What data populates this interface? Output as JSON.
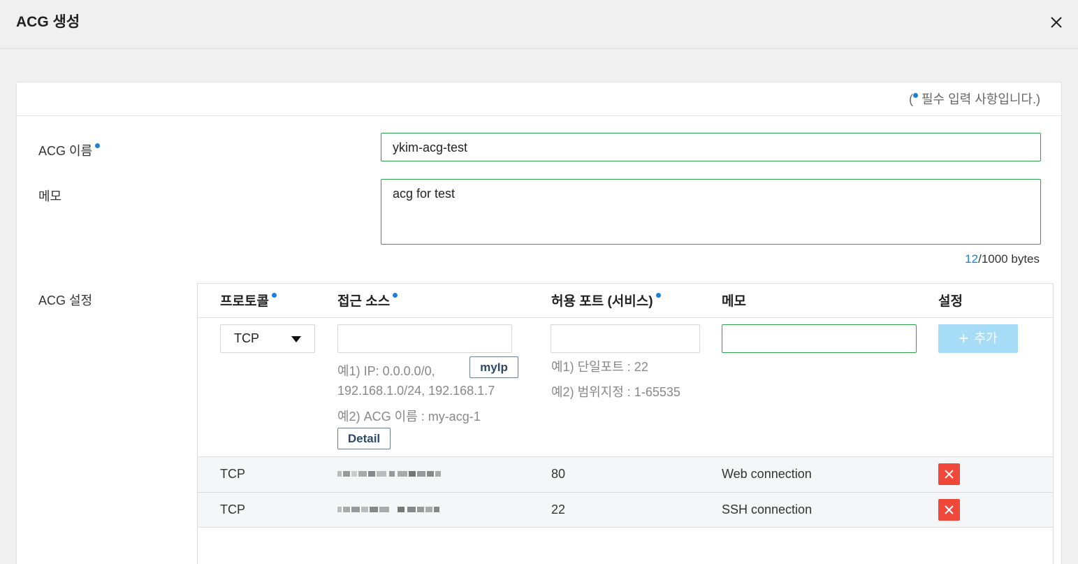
{
  "dialog": {
    "title": "ACG 생성",
    "required_note_open": "(",
    "required_note_text": "필수 입력 사항입니다.)"
  },
  "form": {
    "name_label": "ACG 이름",
    "name_value": "ykim-acg-test",
    "memo_label": "메모",
    "memo_value": "acg for test",
    "memo_count": "12",
    "memo_limit": "/1000 bytes",
    "settings_label": "ACG 설정"
  },
  "acg_table": {
    "headers": {
      "protocol": "프로토콜",
      "source": "접근 소스",
      "port": "허용 포트 (서비스)",
      "memo": "메모",
      "settings": "설정"
    },
    "new_rule": {
      "protocol_selected": "TCP",
      "myip_button": "myIp",
      "source_hint1_line1": "예1) IP: 0.0.0.0/0,",
      "source_hint1_line2": "192.168.1.0/24, 192.168.1.7",
      "source_hint2": "예2) ACG 이름 : my-acg-1",
      "detail_button": "Detail",
      "port_hint1": "예1) 단일포트 : 22",
      "port_hint2": "예2) 범위지정 : 1-65535",
      "add_button": "추가"
    },
    "rows": [
      {
        "protocol": "TCP",
        "port": "80",
        "memo": "Web connection"
      },
      {
        "protocol": "TCP",
        "port": "22",
        "memo": "SSH connection"
      }
    ]
  },
  "colors": {
    "accent_blue": "#1c7fd9",
    "input_border_green": "#2fa04e",
    "add_button_bg": "#a6dcf5",
    "delete_button_bg": "#f0473b"
  },
  "icons": [
    "close-icon",
    "required-dot-icon",
    "caret-down-icon",
    "plus-icon",
    "delete-x-icon"
  ]
}
